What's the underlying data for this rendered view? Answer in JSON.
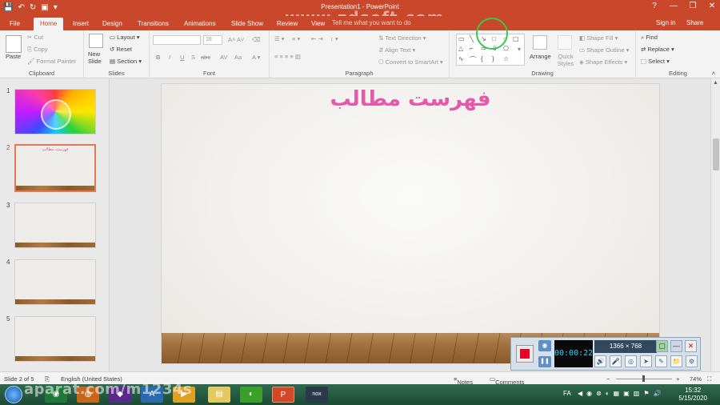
{
  "window": {
    "title": "Presentation1 - PowerPoint",
    "watermark": "www.zdsoft.com",
    "controls": [
      "?",
      "—",
      "❐",
      "✕"
    ]
  },
  "tabs": [
    {
      "label": "File"
    },
    {
      "label": "Home"
    },
    {
      "label": "Insert"
    },
    {
      "label": "Design"
    },
    {
      "label": "Transitions"
    },
    {
      "label": "Animations"
    },
    {
      "label": "Slide Show"
    },
    {
      "label": "Review"
    },
    {
      "label": "View"
    }
  ],
  "tell_me": "Tell me what you want to do",
  "sign_in": "Sign in",
  "share": "Share",
  "ribbon": {
    "clipboard": {
      "label": "Clipboard",
      "paste": "Paste",
      "cut": "Cut",
      "copy": "Copy",
      "format_painter": "Format Painter"
    },
    "slides": {
      "label": "Slides",
      "new_slide": "New\nSlide",
      "layout": "Layout",
      "reset": "Reset",
      "section": "Section"
    },
    "font": {
      "label": "Font",
      "size": "18",
      "bold": "B",
      "italic": "I",
      "underline": "U",
      "shadow": "S",
      "strike": "abc"
    },
    "paragraph": {
      "label": "Paragraph",
      "text_direction": "Text Direction",
      "align_text": "Align Text",
      "convert_smartart": "Convert to SmartArt"
    },
    "drawing": {
      "label": "Drawing",
      "arrange": "Arrange",
      "quick_styles": "Quick Styles",
      "shape_fill": "Shape Fill",
      "shape_outline": "Shape Outline",
      "shape_effects": "Shape Effects"
    },
    "editing": {
      "label": "Editing",
      "find": "Find",
      "replace": "Replace",
      "select": "Select"
    }
  },
  "thumbnails": [
    {
      "num": "1"
    },
    {
      "num": "2",
      "title": "فهرست مطالب"
    },
    {
      "num": "3"
    },
    {
      "num": "4"
    },
    {
      "num": "5"
    }
  ],
  "slide": {
    "title": "فهرست مطالب"
  },
  "status": {
    "slide_count": "Slide 2 of 5",
    "language": "English (United States)",
    "notes": "Notes",
    "comments": "Comments",
    "zoom": "74%"
  },
  "recorder": {
    "timer": "00:00:22",
    "resolution": "1366 × 768"
  },
  "taskbar": {
    "overlay_text": "aparat.com/m1234s",
    "lang": "FA",
    "time": "15:32",
    "date": "5/15/2020"
  },
  "colors": {
    "accent": "#c9472a",
    "slide_title": "#e55aa8",
    "record": "#e3002b"
  }
}
